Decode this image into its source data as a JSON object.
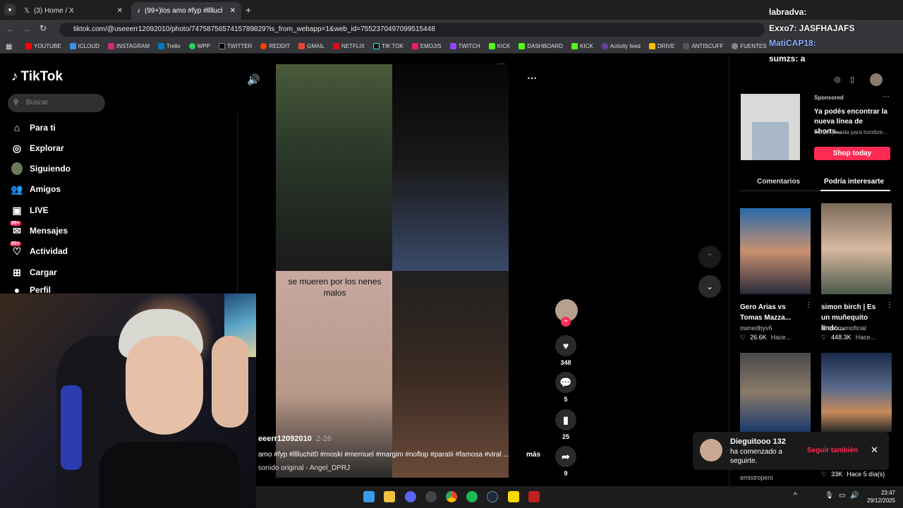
{
  "browser": {
    "tabs": [
      {
        "label": "(3) Home / X"
      },
      {
        "label": "(99+)los amo #fyp #lllluchit0 #"
      }
    ],
    "url": "tiktok.com/@useeerr12092010/photo/7475875657415789829?is_from_webapp=1&web_id=7552370497099515448",
    "bookmarks": [
      "YOUTUBE",
      "ICLOUD",
      "INSTAGRAM",
      "Trello",
      "WPP",
      "TWITTER",
      "REDDIT",
      "GMAIL",
      "NETFLIX",
      "TIK TOK",
      "EMOJIS",
      "TWITCH",
      "KICK",
      "DASHBOARD",
      "KICK",
      "Activity feed",
      "DRIVE",
      "ANTISCUFF",
      "FUENTES"
    ]
  },
  "sidebar": {
    "logo": "TikTok",
    "search_placeholder": "Buscar",
    "items": [
      {
        "label": "Para ti",
        "icon": "home-icon"
      },
      {
        "label": "Explorar",
        "icon": "compass-icon"
      },
      {
        "label": "Siguiendo",
        "icon": "following-avatar-icon"
      },
      {
        "label": "Amigos",
        "icon": "friends-icon"
      },
      {
        "label": "LIVE",
        "icon": "live-icon"
      },
      {
        "label": "Mensajes",
        "icon": "messages-icon",
        "badge": "99+"
      },
      {
        "label": "Actividad",
        "icon": "activity-icon",
        "badge": "99+"
      },
      {
        "label": "Cargar",
        "icon": "upload-icon"
      },
      {
        "label": "Perfil",
        "icon": "profile-icon"
      }
    ]
  },
  "post": {
    "overlay_text": "se mueren por los nenes malos",
    "username": "eeerr12092010",
    "date": "2-26",
    "caption": "amo #fyp #lllluchit0 #moski #mernuel #margim #noflop #paratii #famosa #viral ...",
    "more": "más",
    "sound": "sonido original - Angel_DPRJ",
    "likes": "348",
    "comments": "5",
    "saves": "25",
    "shares": "9"
  },
  "right": {
    "sponsored": "Sponsored",
    "ad_title": "Ya podés encontrar la nueva línea de shorts...",
    "ad_source": "Forum | moda para hombre...",
    "ad_cta": "Shop today",
    "tabs": [
      "Comentarios",
      "Podría interesarte"
    ],
    "videos": [
      {
        "title": "Gero Arias vs Tomas Mazza...",
        "user": "ownedbyv6",
        "likes": "26.6K",
        "time": "Hace..."
      },
      {
        "title": "simon birch | Es un muñequito lindo...",
        "user": "lilresumenoficial",
        "likes": "448.3K",
        "time": "Hace..."
      },
      {
        "title": "",
        "user": "emistropeni",
        "likes": "",
        "time": ""
      },
      {
        "title": "",
        "user": "",
        "likes": "33K",
        "time": "Hace 5 día(s)"
      }
    ]
  },
  "toast": {
    "name": "Dieguitooo 132",
    "message": "ha comenzado a seguirte.",
    "action": "Seguir también"
  },
  "chat_overlay": [
    {
      "text": "labradva:"
    },
    {
      "text": "Exxo7: JASFHAJAFS"
    },
    {
      "text": "MatiCAP18:"
    },
    {
      "text": "sumzs: a"
    }
  ],
  "taskbar": {
    "time": "23:47",
    "date": "29/12/2025"
  },
  "colors": {
    "accent": "#fe2c55",
    "bg": "#000000"
  }
}
